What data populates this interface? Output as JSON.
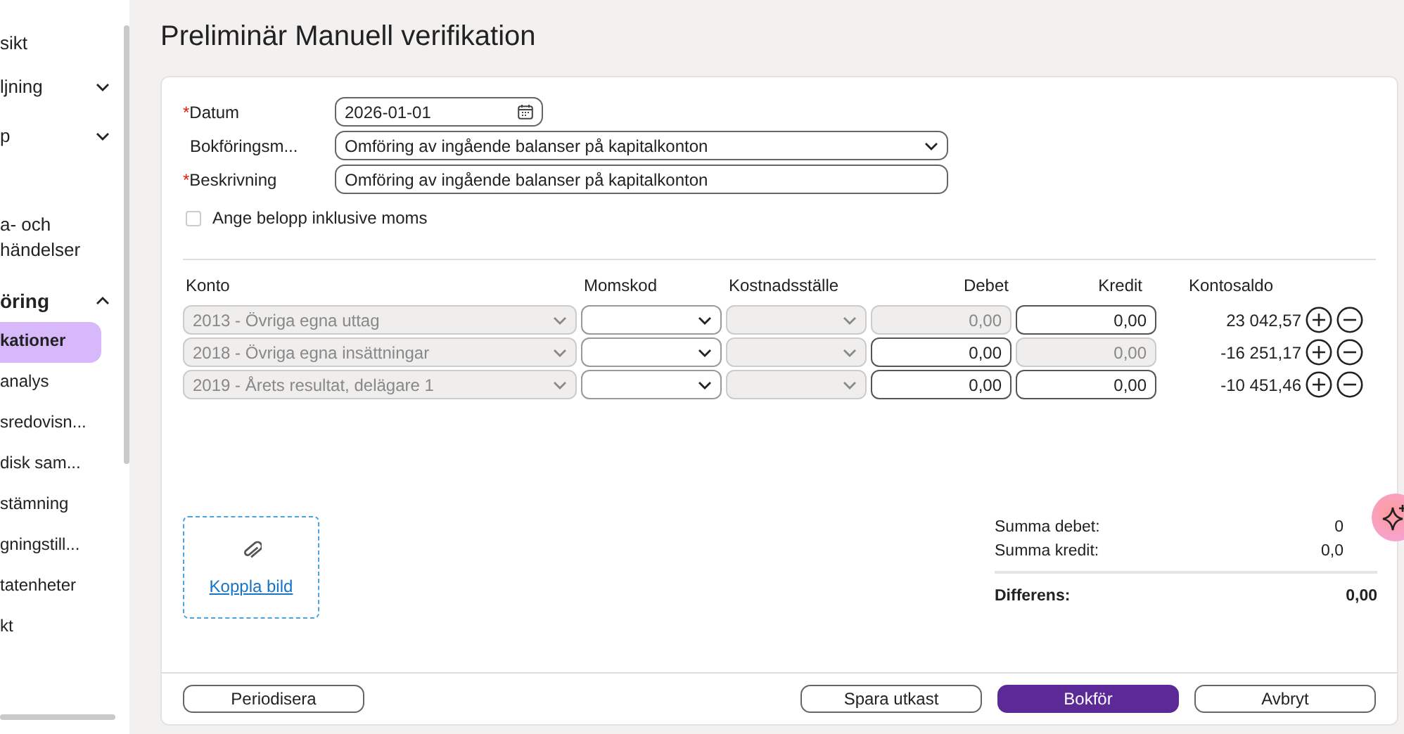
{
  "sidebar": {
    "items": [
      {
        "label": "sikt",
        "kind": "link",
        "selected": false
      },
      {
        "label": "ljning",
        "kind": "group",
        "expanded": false,
        "selected": false
      },
      {
        "label": "p",
        "kind": "group",
        "expanded": false,
        "selected": false
      },
      {
        "label": "a- och\nhändelser",
        "kind": "link",
        "selected": false
      },
      {
        "label": "öring",
        "kind": "group",
        "expanded": true,
        "selected": false
      },
      {
        "label": "kationer",
        "kind": "sub",
        "selected": true
      },
      {
        "label": "analys",
        "kind": "sub",
        "selected": false
      },
      {
        "label": "sredovisn...",
        "kind": "sub",
        "selected": false
      },
      {
        "label": "disk sam...",
        "kind": "sub",
        "selected": false
      },
      {
        "label": "stämning",
        "kind": "sub",
        "selected": false
      },
      {
        "label": "gningstill...",
        "kind": "sub",
        "selected": false
      },
      {
        "label": "tatenheter",
        "kind": "sub",
        "selected": false
      },
      {
        "label": "kt",
        "kind": "sub",
        "selected": false
      }
    ]
  },
  "title": "Preliminär Manuell verifikation",
  "form": {
    "fields": [
      {
        "label": "Datum",
        "required_mark": "*",
        "kind": "date",
        "value": "2026-01-01"
      },
      {
        "label": "Bokföringsm...",
        "kind": "select",
        "value": "Omföring av ingående balanser på kapitalkonton"
      },
      {
        "label": "Beskrivning",
        "required_mark": "*",
        "kind": "text",
        "value": "Omföring av ingående balanser på kapitalkonton"
      }
    ],
    "checkbox": {
      "label": "Ange belopp inklusive moms",
      "checked": false
    }
  },
  "table": {
    "columns": [
      "Konto",
      "Momskod",
      "Kostnadsställe",
      "Debet",
      "Kredit",
      "Kontosaldo"
    ],
    "rows": [
      {
        "konto": "2013 - Övriga egna uttag",
        "debet": "0,00",
        "debet_disabled": true,
        "kredit": "0,00",
        "kredit_disabled": false,
        "saldo": "23 042,57"
      },
      {
        "konto": "2018 - Övriga egna insättningar",
        "debet": "0,00",
        "debet_disabled": false,
        "kredit": "0,00",
        "kredit_disabled": true,
        "saldo": "-16 251,17"
      },
      {
        "konto": "2019 - Årets resultat, delägare 1",
        "debet": "0,00",
        "debet_disabled": false,
        "kredit": "0,00",
        "kredit_disabled": false,
        "saldo": "-10 451,46"
      }
    ]
  },
  "attach": {
    "link": "Koppla bild"
  },
  "summary": {
    "rows": [
      {
        "label": "Summa debet:",
        "value": "0"
      },
      {
        "label": "Summa kredit:",
        "value": "0,0"
      }
    ],
    "total": {
      "label": "Differens:",
      "value": "0,00"
    }
  },
  "footer": {
    "left": "Periodisera",
    "buttons": [
      {
        "label": "Spara utkast",
        "primary": false
      },
      {
        "label": "Bokför",
        "primary": true
      },
      {
        "label": "Avbryt",
        "primary": false
      }
    ]
  }
}
